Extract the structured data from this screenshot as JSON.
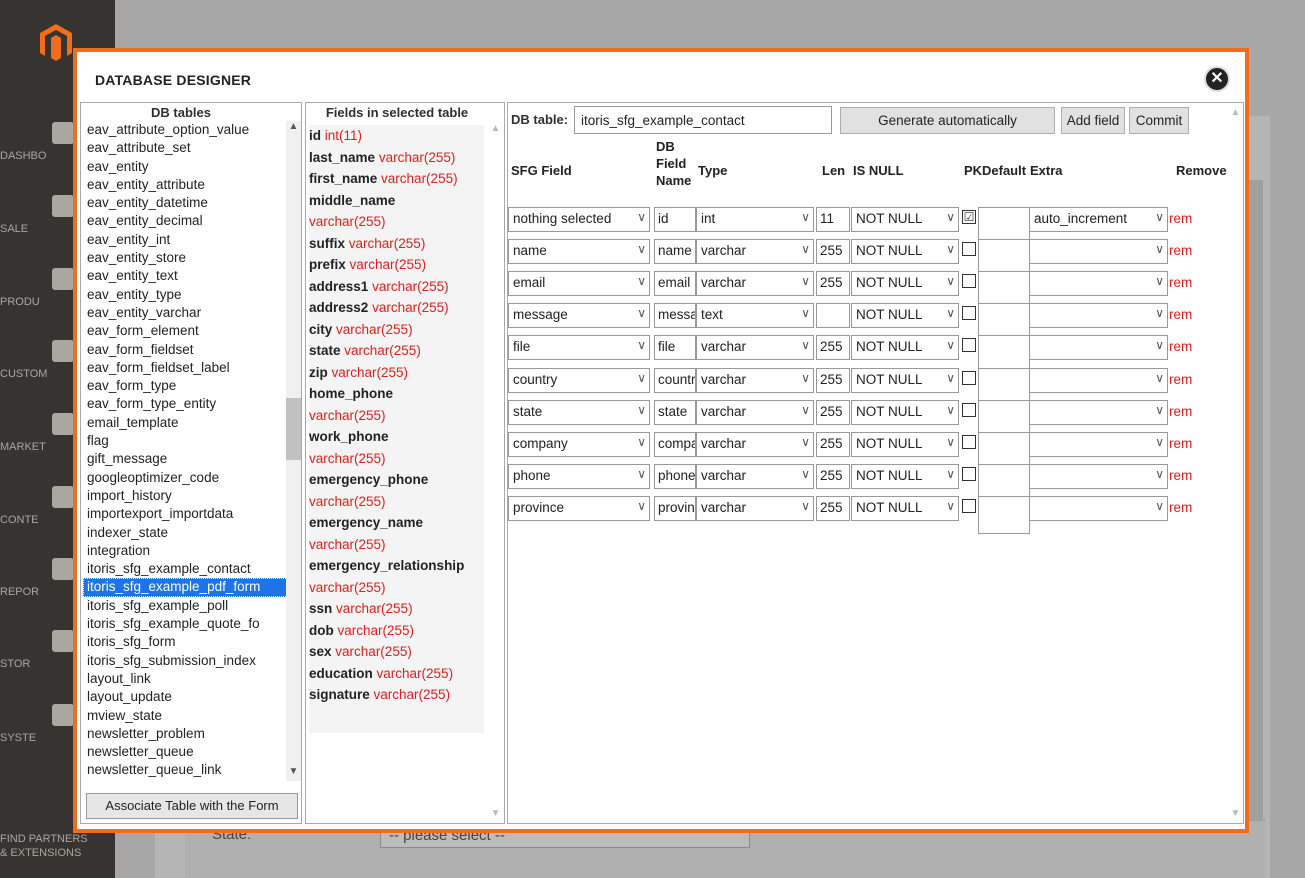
{
  "admin_menu": {
    "items": [
      {
        "label": "DASHBO",
        "icon": "gauge-icon"
      },
      {
        "label": "SALE",
        "icon": "dollar-icon"
      },
      {
        "label": "PRODU",
        "icon": "cube-icon"
      },
      {
        "label": "CUSTOM",
        "icon": "person-icon"
      },
      {
        "label": "MARKET",
        "icon": "megaphone-icon"
      },
      {
        "label": "CONTE",
        "icon": "layout-icon"
      },
      {
        "label": "REPOR",
        "icon": "bar-chart-icon"
      },
      {
        "label": "STOR",
        "icon": "store-icon"
      },
      {
        "label": "SYSTE",
        "icon": "gear-icon"
      }
    ],
    "find_partners_line1": "FIND PARTNERS",
    "find_partners_line2": "& EXTENSIONS"
  },
  "background_form": {
    "state_label": "State:",
    "state_select": "-- please select --"
  },
  "modal": {
    "title": "DATABASE DESIGNER",
    "close_symbol": "✕"
  },
  "db_tables": {
    "header": "DB tables",
    "items": [
      "eav_attribute_option_value",
      "eav_attribute_set",
      "eav_entity",
      "eav_entity_attribute",
      "eav_entity_datetime",
      "eav_entity_decimal",
      "eav_entity_int",
      "eav_entity_store",
      "eav_entity_text",
      "eav_entity_type",
      "eav_entity_varchar",
      "eav_form_element",
      "eav_form_fieldset",
      "eav_form_fieldset_label",
      "eav_form_type",
      "eav_form_type_entity",
      "email_template",
      "flag",
      "gift_message",
      "googleoptimizer_code",
      "import_history",
      "importexport_importdata",
      "indexer_state",
      "integration",
      "itoris_sfg_example_contact",
      "itoris_sfg_example_pdf_form",
      "itoris_sfg_example_poll",
      "itoris_sfg_example_quote_fo",
      "itoris_sfg_form",
      "itoris_sfg_submission_index",
      "layout_link",
      "layout_update",
      "mview_state",
      "newsletter_problem",
      "newsletter_queue",
      "newsletter_queue_link"
    ],
    "selected_index": 25,
    "associate_button": "Associate Table with the Form"
  },
  "fields_in_table": {
    "header": "Fields in selected table",
    "items": [
      {
        "name": "id",
        "type": "int(11)"
      },
      {
        "name": "last_name",
        "type": "varchar(255)"
      },
      {
        "name": "first_name",
        "type": "varchar(255)"
      },
      {
        "name": "middle_name",
        "type": ""
      },
      {
        "name": "",
        "type": "varchar(255)"
      },
      {
        "name": "suffix",
        "type": "varchar(255)"
      },
      {
        "name": "prefix",
        "type": "varchar(255)"
      },
      {
        "name": "address1",
        "type": "varchar(255)"
      },
      {
        "name": "address2",
        "type": "varchar(255)"
      },
      {
        "name": "city",
        "type": "varchar(255)"
      },
      {
        "name": "state",
        "type": "varchar(255)"
      },
      {
        "name": "zip",
        "type": "varchar(255)"
      },
      {
        "name": "home_phone",
        "type": ""
      },
      {
        "name": "",
        "type": "varchar(255)"
      },
      {
        "name": "work_phone",
        "type": ""
      },
      {
        "name": "",
        "type": "varchar(255)"
      },
      {
        "name": "emergency_phone",
        "type": ""
      },
      {
        "name": "",
        "type": "varchar(255)"
      },
      {
        "name": "emergency_name",
        "type": ""
      },
      {
        "name": "",
        "type": "varchar(255)"
      },
      {
        "name": "emergency_relationship",
        "type": ""
      },
      {
        "name": "",
        "type": "varchar(255)"
      },
      {
        "name": "ssn",
        "type": "varchar(255)"
      },
      {
        "name": "dob",
        "type": "varchar(255)"
      },
      {
        "name": "sex",
        "type": "varchar(255)"
      },
      {
        "name": "education",
        "type": "varchar(255)"
      },
      {
        "name": "signature",
        "type": "varchar(255)"
      }
    ]
  },
  "designer": {
    "db_table_label": "DB table:",
    "db_table_value": "itoris_sfg_example_contact",
    "generate_button": "Generate automatically",
    "add_field_button": "Add field",
    "commit_button": "Commit",
    "headers": {
      "sfg_field": "SFG Field",
      "db_field_name_1": "DB",
      "db_field_name_2": "Field",
      "db_field_name_3": "Name",
      "type": "Type",
      "len": "Len",
      "is_null": "IS NULL",
      "pk": "PK",
      "default": "Default",
      "extra": "Extra",
      "remove": "Remove"
    },
    "rows": [
      {
        "sfg_field": "nothing selected",
        "db_field": "id",
        "type": "int",
        "len": "11",
        "is_null": "NOT NULL",
        "pk": "☑",
        "default": "",
        "extra": "auto_increment",
        "remove": "rem"
      },
      {
        "sfg_field": "name",
        "db_field": "name",
        "type": "varchar",
        "len": "255",
        "is_null": "NOT NULL",
        "pk": "",
        "default": "",
        "extra": "",
        "remove": "rem"
      },
      {
        "sfg_field": "email",
        "db_field": "email",
        "type": "varchar",
        "len": "255",
        "is_null": "NOT NULL",
        "pk": "",
        "default": "",
        "extra": "",
        "remove": "rem"
      },
      {
        "sfg_field": "message",
        "db_field": "message",
        "type": "text",
        "len": "",
        "is_null": "NOT NULL",
        "pk": "",
        "default": "",
        "extra": "",
        "remove": "rem"
      },
      {
        "sfg_field": "file",
        "db_field": "file",
        "type": "varchar",
        "len": "255",
        "is_null": "NOT NULL",
        "pk": "",
        "default": "",
        "extra": "",
        "remove": "rem"
      },
      {
        "sfg_field": "country",
        "db_field": "country",
        "type": "varchar",
        "len": "255",
        "is_null": "NOT NULL",
        "pk": "",
        "default": "",
        "extra": "",
        "remove": "rem"
      },
      {
        "sfg_field": "state",
        "db_field": "state",
        "type": "varchar",
        "len": "255",
        "is_null": "NOT NULL",
        "pk": "",
        "default": "",
        "extra": "",
        "remove": "rem"
      },
      {
        "sfg_field": "company",
        "db_field": "company",
        "type": "varchar",
        "len": "255",
        "is_null": "NOT NULL",
        "pk": "",
        "default": "",
        "extra": "",
        "remove": "rem"
      },
      {
        "sfg_field": "phone",
        "db_field": "phone",
        "type": "varchar",
        "len": "255",
        "is_null": "NOT NULL",
        "pk": "",
        "default": "",
        "extra": "",
        "remove": "rem"
      },
      {
        "sfg_field": "province",
        "db_field": "province",
        "type": "varchar",
        "len": "255",
        "is_null": "NOT NULL",
        "pk": "",
        "default": "",
        "extra": "",
        "remove": "rem"
      }
    ]
  },
  "colors": {
    "modal_border": "#f06d1e",
    "selection": "#1e73e6",
    "type_red": "#e0201e",
    "admin_sidebar": "#373330"
  }
}
